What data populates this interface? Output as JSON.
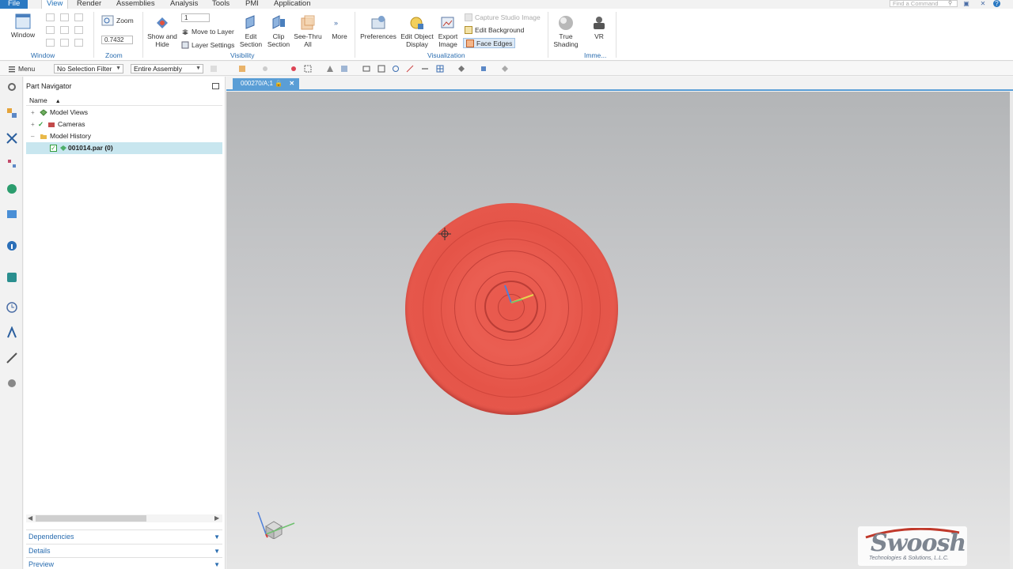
{
  "tabs": [
    "File",
    "View",
    "Render",
    "Assemblies",
    "Analysis",
    "Tools",
    "PMI",
    "Application"
  ],
  "active_tab": "View",
  "find_command_placeholder": "Find a Command",
  "ribbon": {
    "window": {
      "label": "Window",
      "group": "Window"
    },
    "zoom": {
      "label": "Zoom",
      "value": "0.7432",
      "group": "Zoom"
    },
    "layer_combo": "1",
    "show_hide": "Show and Hide",
    "move_to_layer": "Move to Layer",
    "layer_settings": "Layer Settings",
    "edit_section": "Edit Section",
    "clip_section": "Clip Section",
    "see_thru_all": "See-Thru All",
    "more": "More",
    "visibility_group": "Visibility",
    "preferences": "Preferences",
    "edit_object_display": "Edit Object Display",
    "export_image": "Export Image",
    "capture_studio_image": "Capture Studio Image",
    "edit_background": "Edit Background",
    "face_edges": "Face Edges",
    "visualization_group": "Visualization",
    "true_shading": "True Shading",
    "vr": "VR",
    "imme_group": "Imme..."
  },
  "toolbar": {
    "menu": "Menu",
    "selection_filter": "No Selection Filter",
    "scope": "Entire Assembly"
  },
  "navigator": {
    "title": "Part Navigator",
    "column_name": "Name",
    "rows": [
      {
        "label": "Model Views"
      },
      {
        "label": "Cameras"
      },
      {
        "label": "Model History"
      },
      {
        "label": "001014.par (0)"
      }
    ],
    "panes": [
      "Dependencies",
      "Details",
      "Preview"
    ]
  },
  "document_tab": "000270/A;1",
  "logo": {
    "word": "Swoosh",
    "tagline": "Technologies & Solutions, L.L.C."
  },
  "colors": {
    "accent": "#2b79c2",
    "part": "#e8574b",
    "tab": "#5a9ed6"
  }
}
